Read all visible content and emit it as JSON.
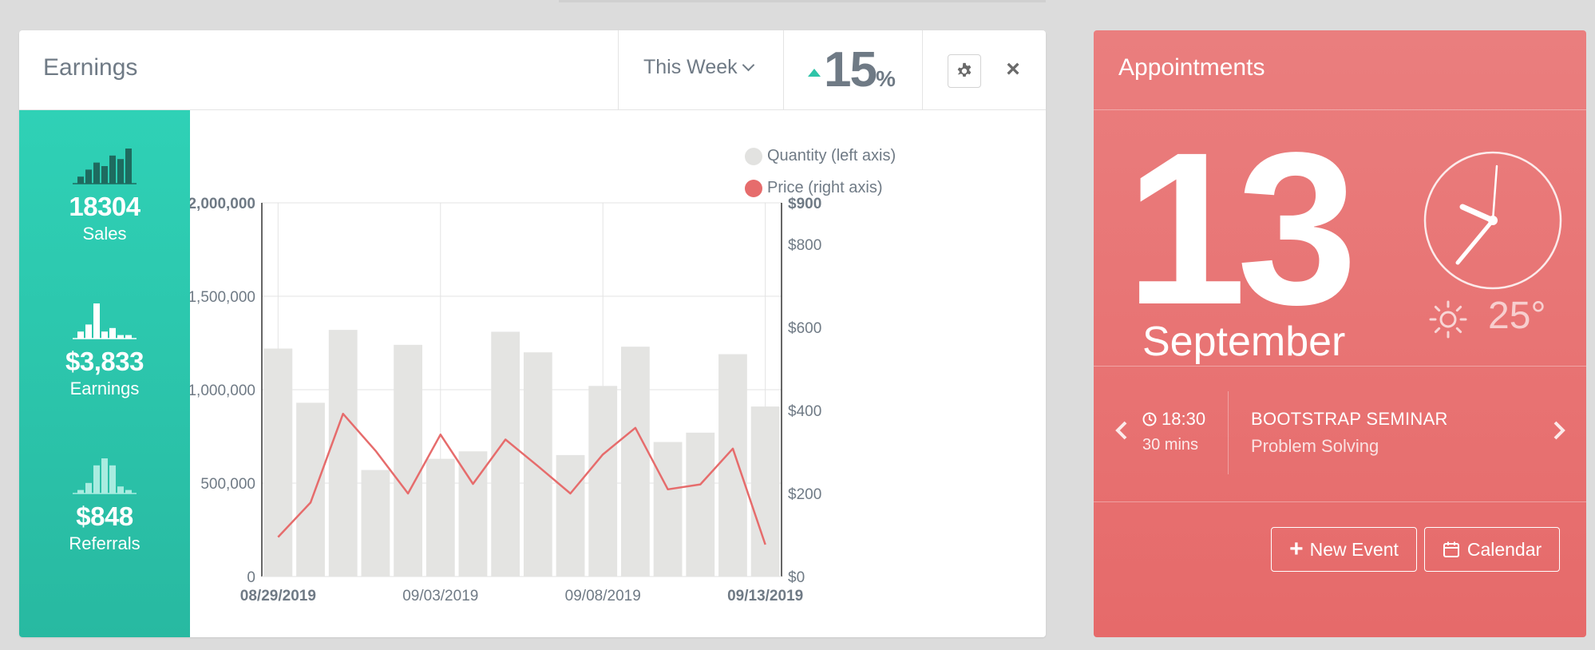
{
  "earnings": {
    "title": "Earnings",
    "period_label": "This Week",
    "change": {
      "value": "15",
      "unit": "%"
    },
    "stats": [
      {
        "value": "18304",
        "label": "Sales",
        "bars": [
          2,
          4,
          6,
          5,
          8,
          7,
          10
        ]
      },
      {
        "value": "$3,833",
        "label": "Earnings",
        "bars": [
          2,
          4,
          10,
          2,
          3,
          1,
          1
        ]
      },
      {
        "value": "$848",
        "label": "Referrals",
        "bars": [
          1,
          3,
          8,
          10,
          8,
          2,
          1
        ]
      }
    ]
  },
  "chart_data": {
    "type": "bar",
    "legend": [
      {
        "name": "Quantity (left axis)",
        "color": "#e2e2e0"
      },
      {
        "name": "Price (right axis)",
        "color": "#e66c6c"
      }
    ],
    "left_axis": {
      "ticks": [
        "0",
        "500,000",
        "1,000,000",
        "1,500,000",
        "2,000,000"
      ],
      "range": [
        0,
        2000000
      ]
    },
    "right_axis": {
      "ticks": [
        "$0",
        "$200",
        "$400",
        "$600",
        "$800",
        "$900"
      ],
      "range": [
        0,
        900
      ]
    },
    "x_ticks": [
      "08/29/2019",
      "09/03/2019",
      "09/08/2019",
      "09/13/2019"
    ],
    "series": [
      {
        "name": "Quantity (left axis)",
        "type": "bar",
        "values": [
          1220000,
          930000,
          1320000,
          570000,
          1240000,
          630000,
          670000,
          1310000,
          1200000,
          650000,
          1020000,
          1230000,
          720000,
          770000,
          1190000,
          910000
        ]
      },
      {
        "name": "Price (right axis)",
        "type": "line",
        "values": [
          95,
          178,
          392,
          303,
          200,
          342,
          223,
          330,
          266,
          200,
          294,
          358,
          210,
          222,
          308,
          77
        ]
      }
    ]
  },
  "appointments": {
    "title": "Appointments",
    "day": "13",
    "month": "September",
    "temperature": "25°",
    "event": {
      "time": "18:30",
      "duration": "30 mins",
      "title": "BOOTSTRAP SEMINAR",
      "subtitle": "Problem Solving"
    },
    "buttons": {
      "new_event": "New Event",
      "calendar": "Calendar"
    }
  }
}
